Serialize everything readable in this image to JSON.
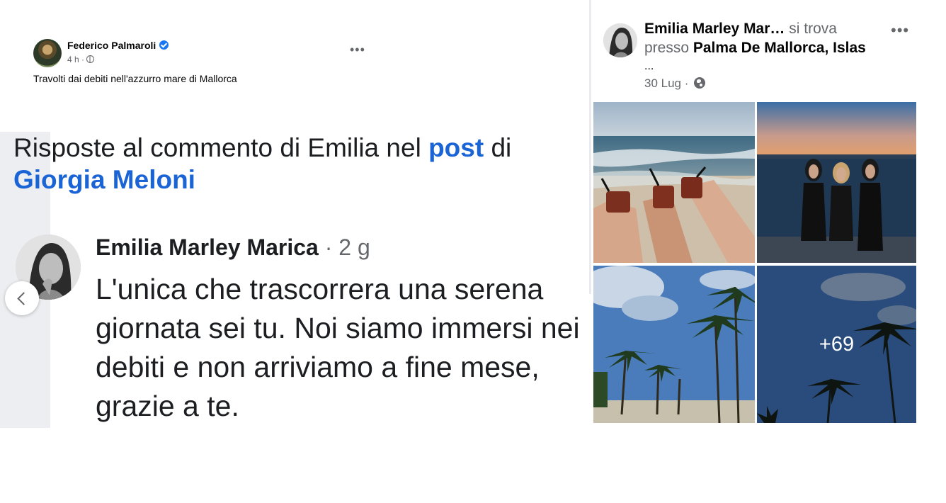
{
  "post": {
    "author": "Federico Palmaroli",
    "time": "4 h ·",
    "caption": "Travolti dai debiti nell'azzurro mare di Mallorca",
    "more_label": "•••"
  },
  "screenshot": {
    "heading_prefix": "Risposte al commento di Emilia nel ",
    "heading_link": "post",
    "heading_mid": " di",
    "heading_name": "Giorgia Meloni",
    "comment_author": "Emilia Marley Marica",
    "comment_time": " · 2 g",
    "comment_text": "L'unica che trascorrera una serena giornata sei tu. Noi siamo immersi nei debiti e non arriviamo a fine mese, grazie a te."
  },
  "card": {
    "author": "Emilia Marley Mar",
    "ellipsis": "…",
    "checkin_text": " si trova presso ",
    "place": "Palma De Mallorca, Islas",
    "overflow": "...",
    "date": "30 Lug ·",
    "more_label": "•••",
    "more_photos": "+69"
  },
  "icons": {
    "verified": "verified-badge-icon",
    "audience": "globe-icon",
    "prev": "chevron-left-icon"
  },
  "colors": {
    "link_blue": "#1a64d6",
    "verified_blue": "#1877f2",
    "muted": "#65676b"
  }
}
